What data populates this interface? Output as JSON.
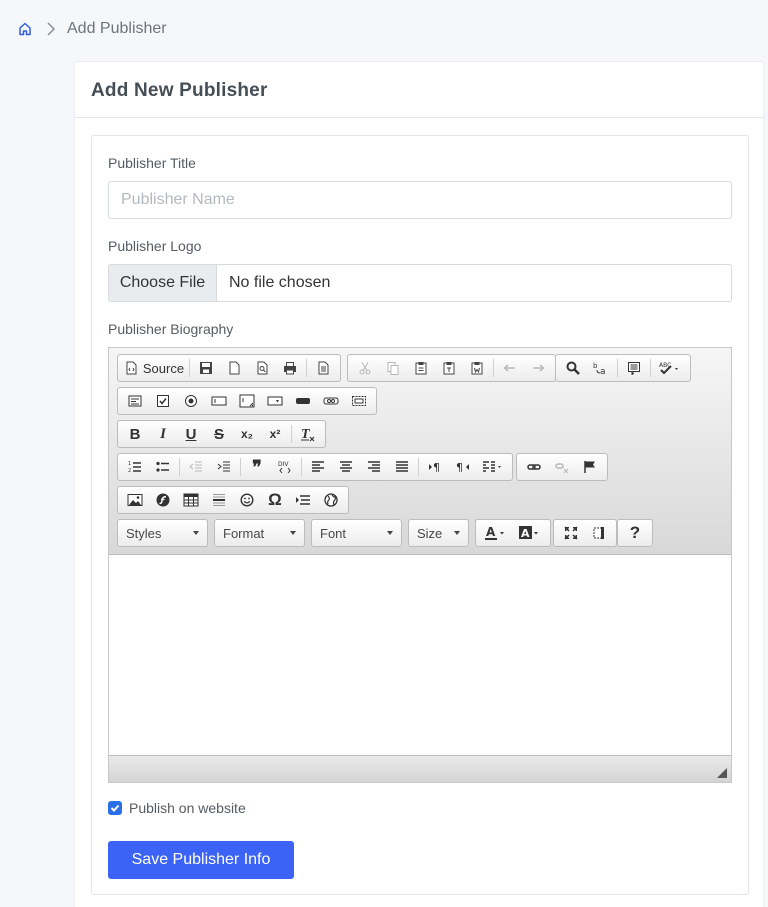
{
  "breadcrumb": {
    "current": "Add Publisher"
  },
  "card": {
    "title": "Add New Publisher"
  },
  "form": {
    "title_label": "Publisher Title",
    "title_placeholder": "Publisher Name",
    "logo_label": "Publisher Logo",
    "file_button": "Choose File",
    "file_status": "No file chosen",
    "bio_label": "Publisher Biography",
    "publish_label": "Publish on website",
    "publish_checked": true,
    "save_label": "Save Publisher Info"
  },
  "editor": {
    "source_label": "Source",
    "combos": {
      "styles": "Styles",
      "format": "Format",
      "font": "Font",
      "size": "Size"
    },
    "glyphs": {
      "bold": "B",
      "italic": "I",
      "underline": "U",
      "strike": "S",
      "subscript": "x₂",
      "superscript": "x²",
      "quote": "❞",
      "omega": "Ω",
      "help": "?"
    }
  },
  "colors": {
    "accent": "#3b63f6",
    "checkbox": "#2a6ee8"
  }
}
